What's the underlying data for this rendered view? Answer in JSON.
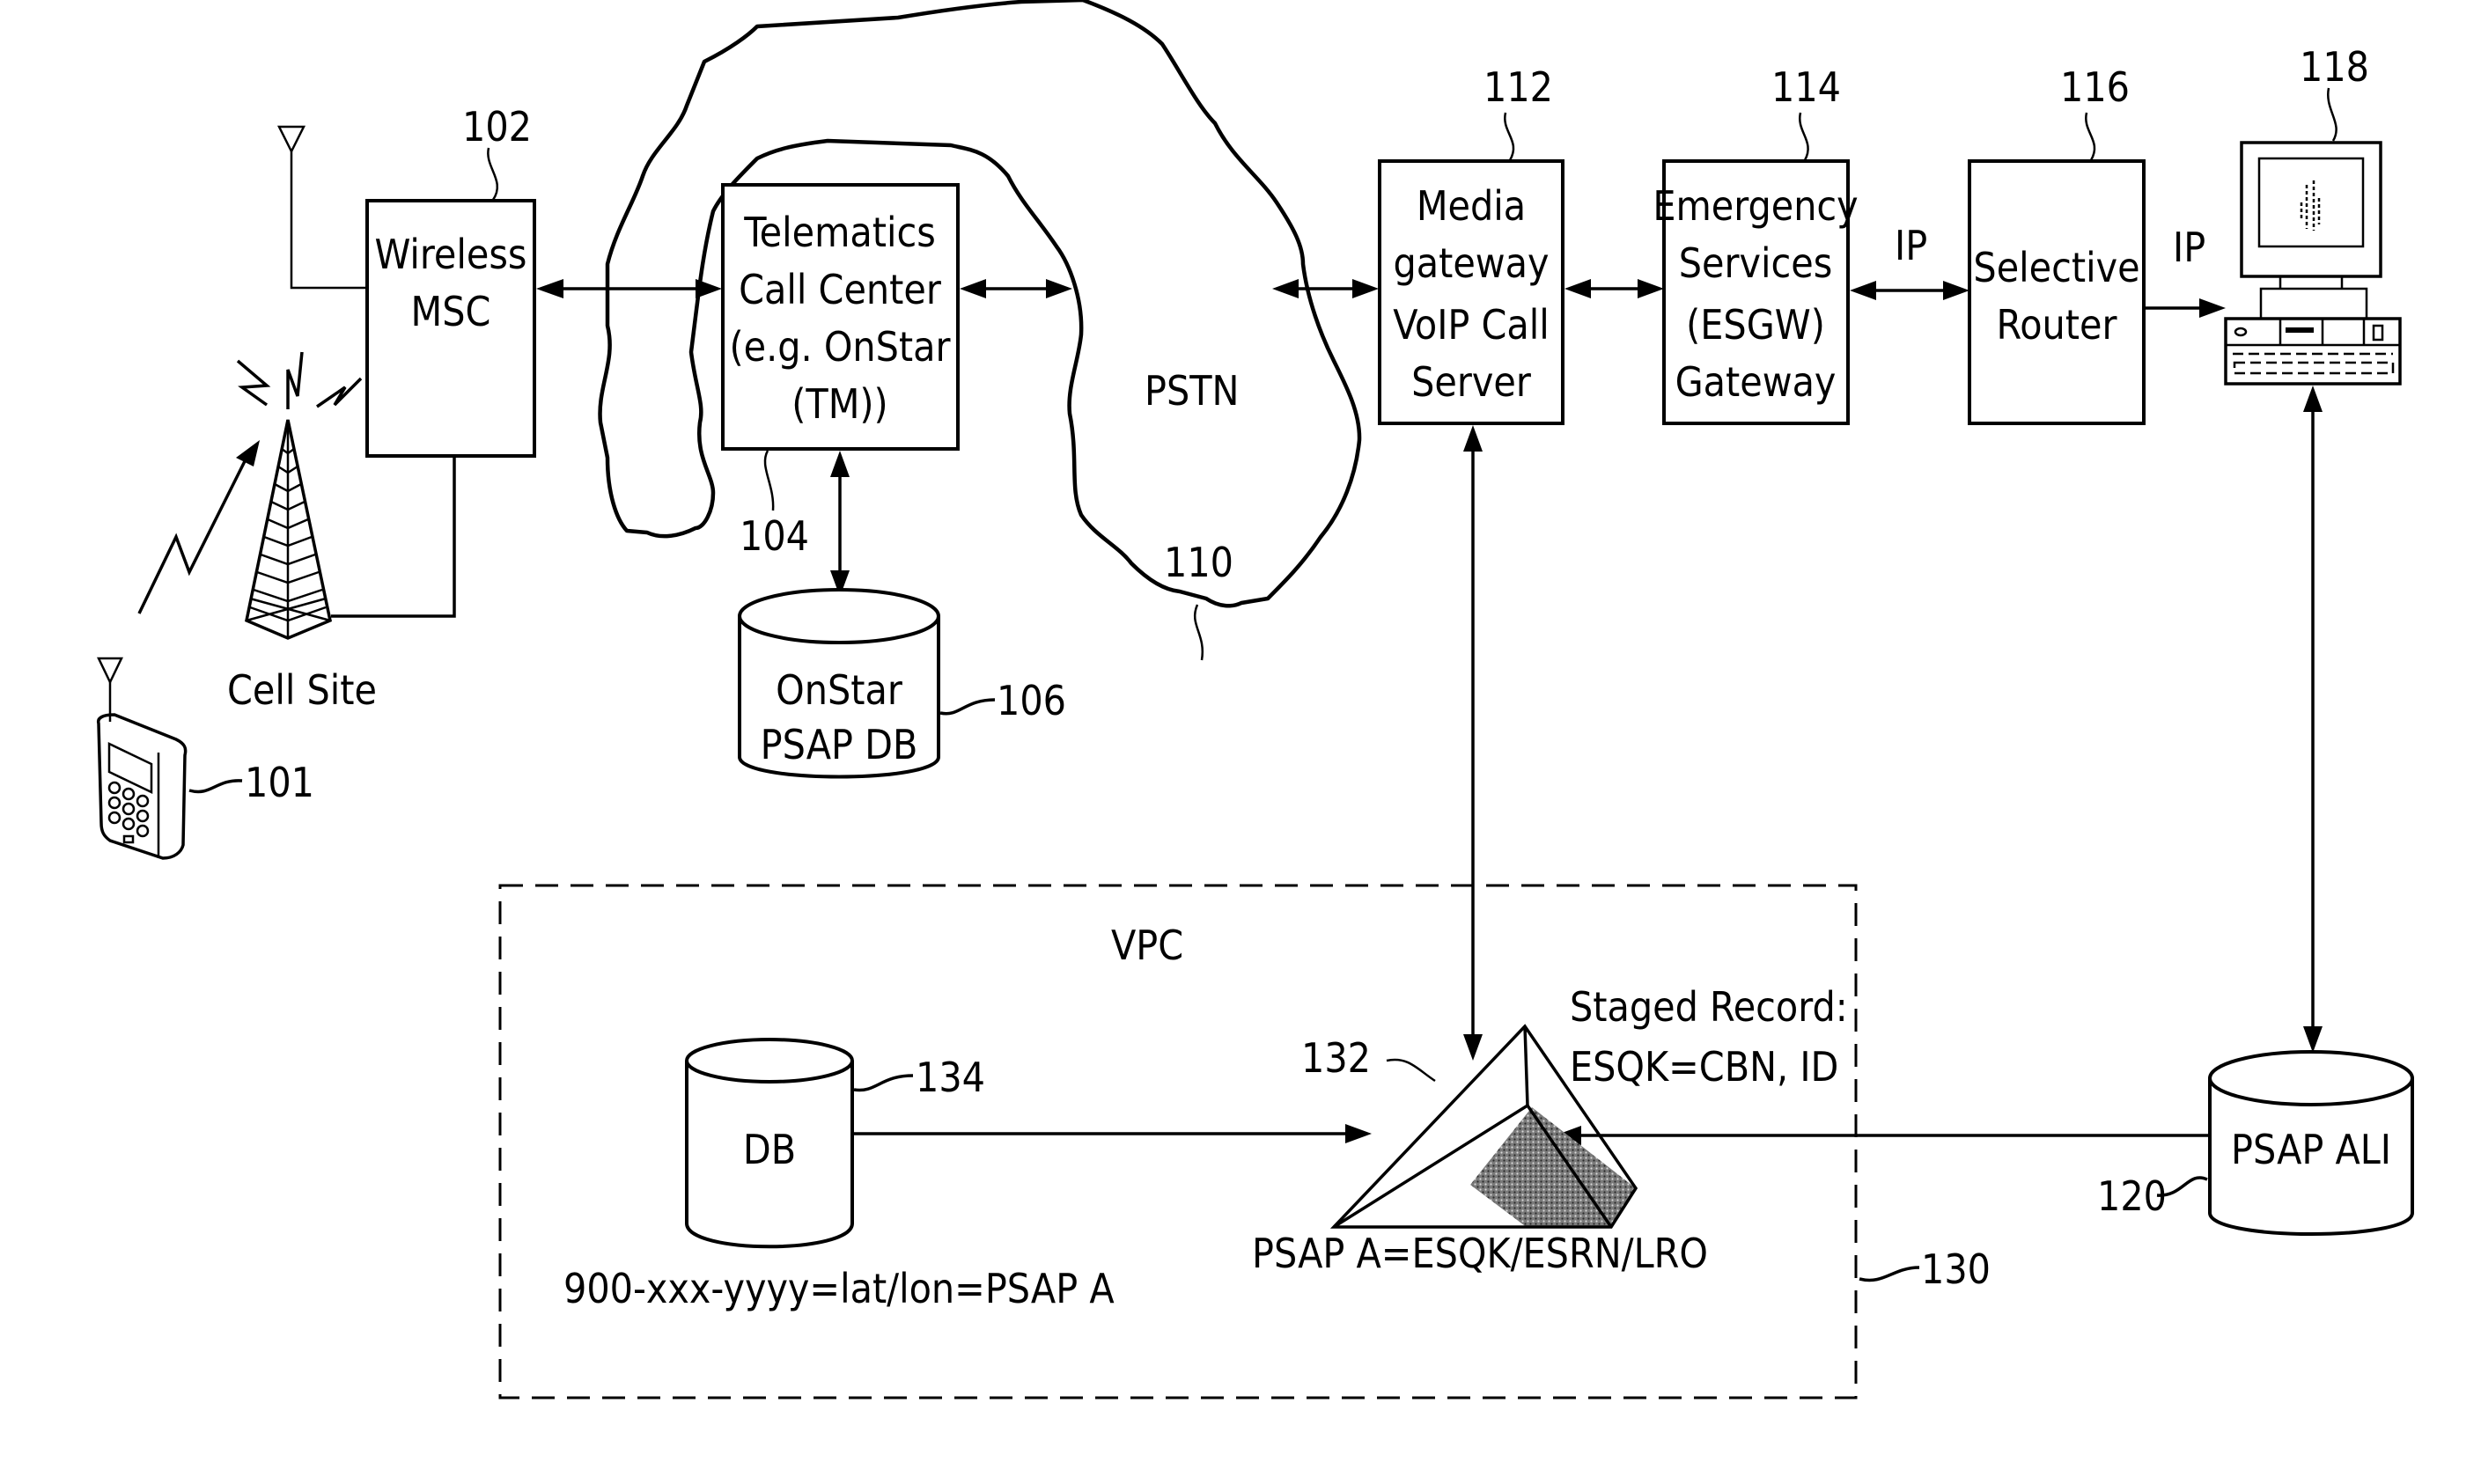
{
  "figure": {
    "type": "network-block-diagram",
    "components": {
      "mobile_device": {
        "ref": "101"
      },
      "cell_site": {
        "label": "Cell Site"
      },
      "wireless_msc": {
        "ref": "102",
        "lines": [
          "Wireless",
          "MSC"
        ]
      },
      "telematics_call_center": {
        "ref": "104",
        "lines": [
          "Telematics",
          "Call Center",
          "(e.g. OnStar",
          "(TM))"
        ]
      },
      "onstar_psap_db": {
        "ref": "106",
        "lines": [
          "OnStar",
          "PSAP DB"
        ]
      },
      "pstn": {
        "ref": "110",
        "label": "PSTN"
      },
      "media_gateway": {
        "ref": "112",
        "lines": [
          "Media",
          "gateway",
          "VoIP Call",
          "Server"
        ]
      },
      "esgw": {
        "ref": "114",
        "lines": [
          "Emergency",
          "Services",
          "(ESGW)",
          "Gateway"
        ]
      },
      "selective_router": {
        "ref": "116",
        "lines": [
          "Selective",
          "Router"
        ]
      },
      "psap_terminal": {
        "ref": "118"
      },
      "psap_ali": {
        "ref": "120",
        "label": "PSAP ALI"
      },
      "vpc": {
        "ref": "130",
        "label": "VPC"
      },
      "vpc_engine": {
        "ref": "132",
        "caption": "PSAP A=ESQK/ESRN/LRO"
      },
      "vpc_db": {
        "ref": "134",
        "label": "DB",
        "caption": "900-xxx-yyyy=lat/lon=PSAP A"
      }
    },
    "link_labels": {
      "esgw_to_router": "IP",
      "router_to_psap": "IP"
    },
    "staged_record": {
      "title": "Staged Record:",
      "value": "ESQK=CBN, ID"
    }
  }
}
